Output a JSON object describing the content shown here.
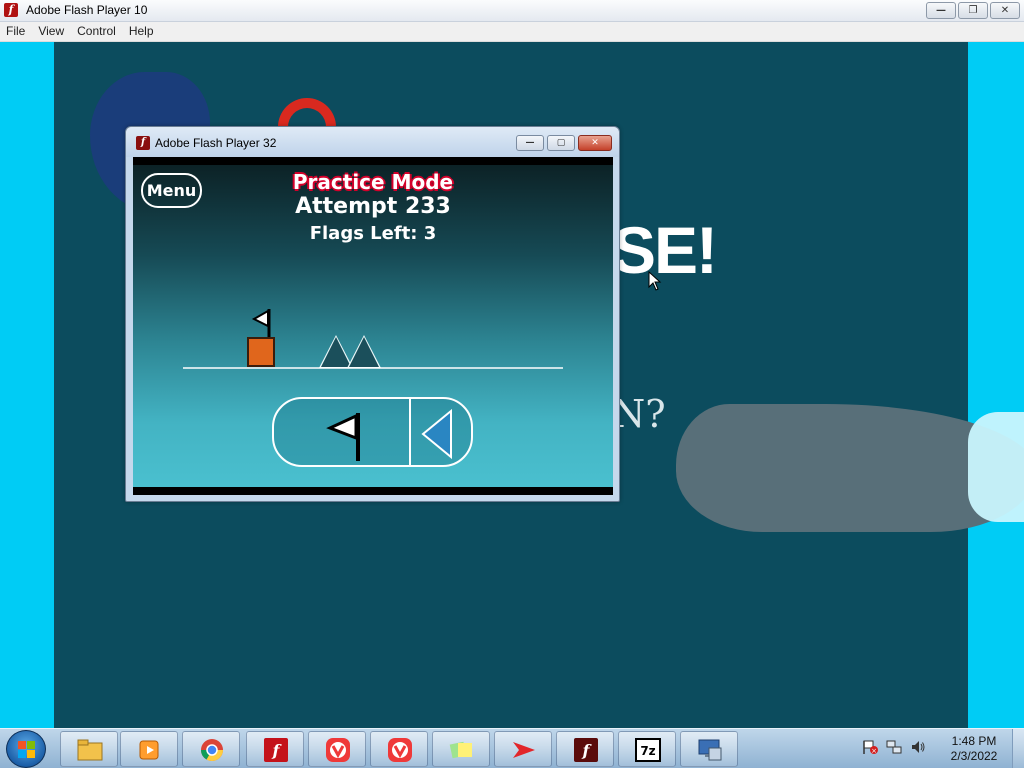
{
  "outer_window": {
    "title": "Adobe Flash Player 10",
    "controls": {
      "minimize": "—",
      "restore": "❐",
      "close": "✕"
    }
  },
  "menubar": {
    "items": [
      "File",
      "View",
      "Control",
      "Help"
    ]
  },
  "background_stage": {
    "partial_title": "SE!",
    "partial_question": "N?"
  },
  "inner_window": {
    "title": "Adobe Flash Player 32",
    "controls": {
      "minimize": "—",
      "restore": "▢",
      "close": "✕"
    }
  },
  "game": {
    "menu_label": "Menu",
    "mode": "Practice Mode",
    "attempt": "Attempt 233",
    "flags_left": "Flags Left: 3"
  },
  "taskbar": {
    "apps": [
      "windows-explorer",
      "media-player",
      "chrome",
      "flash-player",
      "vivaldi",
      "vivaldi",
      "sticky-notes",
      "app-red-arrow",
      "flash-player",
      "7-zip",
      "remote-desktop"
    ],
    "icon_7zip_label": "7z",
    "clock_time": "1:48 PM",
    "clock_date": "2/3/2022"
  }
}
